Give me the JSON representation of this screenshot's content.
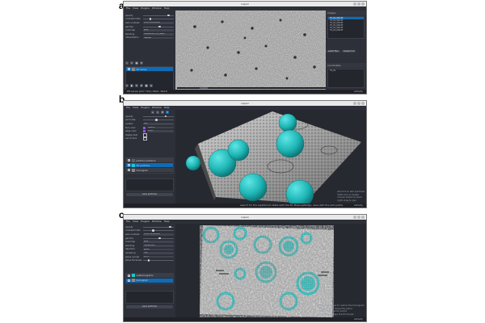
{
  "panels": [
    {
      "letter": "a",
      "window_title": "napari",
      "menu": [
        "File",
        "View",
        "Plugins",
        "Window",
        "Help"
      ],
      "layer_controls": [
        {
          "label": "opacity"
        },
        {
          "label": "contrast limits"
        },
        {
          "label": "auto-contrast",
          "value": "once   continuous"
        },
        {
          "label": "gamma"
        },
        {
          "label": "colormap",
          "value": "gray"
        },
        {
          "label": "blending",
          "value": "translucent_no_depth"
        },
        {
          "label": "interpolation",
          "value": "nearest"
        }
      ],
      "layers": [
        {
          "name": "tiff series",
          "selected": true
        }
      ],
      "right_dock": {
        "files_title": "Images",
        "files": [
          "TS_01_001.tif",
          "TS_01_002.tif",
          "TS_01_003.tif",
          "TS_01_004.tif",
          "TS_01_005.tif",
          "TS_01_006.tif"
        ],
        "buttons": [
          "select files",
          "deselect all"
        ],
        "coords_title": "coordinates",
        "coord_item": "TS_01",
        "action": "open 3D viewer (Shift-Tab)"
      },
      "status": "tiff series   [227 719]: 2622, 184.8",
      "status_right": "activity"
    },
    {
      "letter": "b",
      "window_title": "napari",
      "menu": [
        "File",
        "View",
        "Plugins",
        "Window",
        "Help"
      ],
      "layer_controls": [
        {
          "label": "opacity"
        },
        {
          "label": "point size"
        },
        {
          "label": "symbol",
          "value": "disc"
        },
        {
          "label": "face color",
          "value": "#00ffff"
        },
        {
          "label": "edge color",
          "value": "#ffffff"
        },
        {
          "label": "display text"
        },
        {
          "label": "out of slice"
        }
      ],
      "layers": [
        {
          "name": "particle positions",
          "selected": false
        },
        {
          "name": "3D particles",
          "selected": true
        },
        {
          "name": "tomogram",
          "selected": false
        }
      ],
      "bottom_buttons": [
        "save particles"
      ],
      "annotation": "Alt-click to add particles\nShift-click to delete\nmouse wheel to zoom\nright-drag to pan",
      "status": "search for the equilibrium state with the 3D MissingWedge, save with the add points",
      "status_right": "activity"
    },
    {
      "letter": "c",
      "window_title": "napari",
      "menu": [
        "File",
        "View",
        "Plugins",
        "Window",
        "Help"
      ],
      "layer_controls": [
        {
          "label": "opacity"
        },
        {
          "label": "contrast limits"
        },
        {
          "label": "auto-contrast",
          "value": "once   continuous"
        },
        {
          "label": "gamma"
        },
        {
          "label": "colormap",
          "value": "gray"
        },
        {
          "label": "blending",
          "value": "translucent"
        },
        {
          "label": "depiction",
          "value": "plane"
        },
        {
          "label": "rendering",
          "value": "mip"
        },
        {
          "label": "plane normal",
          "value": "z   y   x"
        },
        {
          "label": "plane thickness"
        }
      ],
      "layers": [
        {
          "name": "subtomograms",
          "selected": false
        },
        {
          "name": "tomogram",
          "selected": true
        }
      ],
      "bottom_buttons": [
        "save particles"
      ],
      "annotation": "drag the plane to reslice the tomogram\nshift-drag to move the plane\nalong the normal vector\nscroll to change the thickness",
      "status": "",
      "status_right": "activity"
    }
  ],
  "colors": {
    "accent": "#0f6bb5",
    "particle": "#1fc7c7",
    "dock": "#2d3038",
    "canvas": "#262930"
  }
}
